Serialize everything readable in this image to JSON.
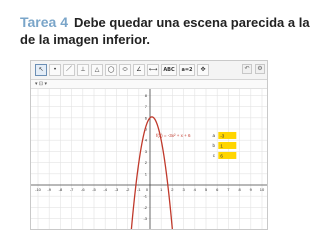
{
  "heading": {
    "task_number": "Tarea 4",
    "instruction": "Debe quedar una escena parecida a la de la imagen inferior."
  },
  "toolbar": {
    "tools": [
      {
        "icon": "move-arrow-icon",
        "glyph": "↖",
        "selected": true
      },
      {
        "icon": "point-icon",
        "glyph": "•"
      },
      {
        "icon": "line-icon",
        "glyph": "／"
      },
      {
        "icon": "perpendicular-icon",
        "glyph": "⊥"
      },
      {
        "icon": "polygon-icon",
        "glyph": "△"
      },
      {
        "icon": "circle-icon",
        "glyph": "◯"
      },
      {
        "icon": "ellipse-icon",
        "glyph": "⬭"
      },
      {
        "icon": "angle-icon",
        "glyph": "∠"
      },
      {
        "icon": "reflect-icon",
        "glyph": "⟷"
      },
      {
        "icon": "text-tool-icon",
        "glyph": "ABC",
        "wide": true
      },
      {
        "icon": "slider-icon",
        "glyph": "a=2",
        "wide": true
      },
      {
        "icon": "move-view-icon",
        "glyph": "✥"
      }
    ],
    "window_controls": [
      {
        "icon": "undo-icon",
        "glyph": "↶"
      },
      {
        "icon": "settings-icon",
        "glyph": "⚙"
      }
    ]
  },
  "style_bar": {
    "label": "▾  ⊡ ▾"
  },
  "graph": {
    "x_range": [
      -10,
      10
    ],
    "y_range": [
      -5,
      9
    ],
    "x_tick_labels": [
      "-10",
      "-9",
      "-8",
      "-7",
      "-6",
      "-5",
      "-4",
      "-3",
      "-2",
      "-1",
      "0",
      "1",
      "2",
      "3",
      "4",
      "5",
      "6",
      "7",
      "8",
      "9",
      "10"
    ],
    "y_tick_labels": [
      "-4",
      "-3",
      "-2",
      "-1",
      "1",
      "2",
      "3",
      "4",
      "5",
      "6",
      "7",
      "8"
    ],
    "function": {
      "label": "f(x) = -3x² + x + 6",
      "a": -3,
      "b": 1,
      "c": 6,
      "color": "#c0392b"
    },
    "sliders": [
      {
        "name": "a",
        "value": "-3"
      },
      {
        "name": "b",
        "value": "1"
      },
      {
        "name": "c",
        "value": "6"
      }
    ],
    "slider_color": "#ffd500"
  },
  "chart_data": {
    "type": "line",
    "title": "",
    "xlabel": "",
    "ylabel": "",
    "xlim": [
      -10,
      10
    ],
    "ylim": [
      -5,
      9
    ],
    "series": [
      {
        "name": "f(x) = -3x² + x + 6",
        "formula": "-3x^2 + x + 6"
      }
    ]
  }
}
